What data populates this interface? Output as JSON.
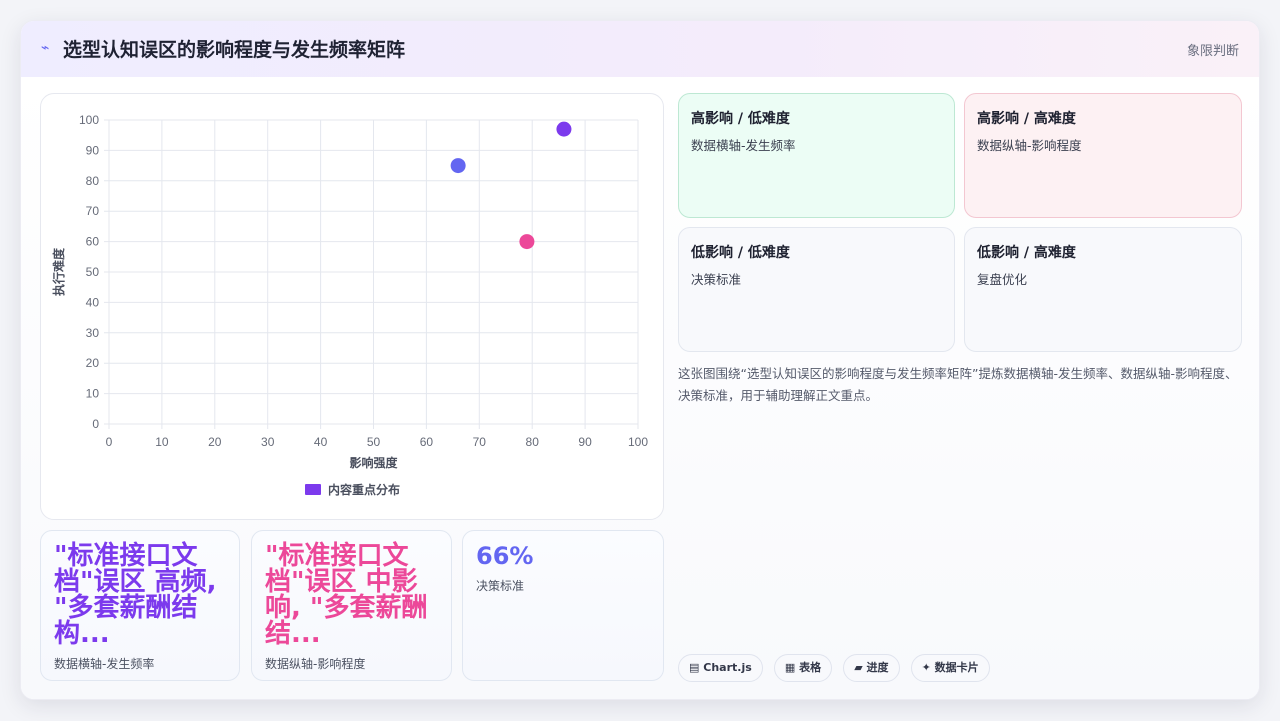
{
  "header": {
    "icon": "lightning-icon",
    "title": "选型认知误区的影响程度与发生频率矩阵",
    "right_label": "象限判断"
  },
  "chart_data": {
    "type": "scatter",
    "xlabel": "影响强度",
    "ylabel": "执行难度",
    "xlim": [
      0,
      100
    ],
    "ylim": [
      0,
      100
    ],
    "xticks": [
      "0",
      "10",
      "20",
      "30",
      "40",
      "50",
      "60",
      "70",
      "80",
      "90",
      "100"
    ],
    "yticks": [
      "0",
      "10",
      "20",
      "30",
      "40",
      "50",
      "60",
      "70",
      "80",
      "90",
      "100"
    ],
    "grid": true,
    "legend_position": "bottom",
    "series": [
      {
        "name": "内容重点分布",
        "color": "#7c3aed",
        "points": [
          {
            "x": 66,
            "y": 85,
            "color": "#6366f1"
          },
          {
            "x": 86,
            "y": 97,
            "color": "#7c3aed"
          },
          {
            "x": 79,
            "y": 60,
            "color": "#ec4899"
          }
        ]
      }
    ]
  },
  "stats": [
    {
      "value": "\"标准接口文档\"误区 高频, \"多套薪酬结构...",
      "label": "数据横轴-发生频率",
      "color": "#7c3aed"
    },
    {
      "value": "\"标准接口文档\"误区 中影响, \"多套薪酬结...",
      "label": "数据纵轴-影响程度",
      "color": "#ec4899"
    },
    {
      "value": "66%",
      "label": "决策标准",
      "color": "#6366f1"
    }
  ],
  "quadrants": [
    {
      "title": "高影响 / 低难度",
      "subtitle": "数据横轴-发生频率",
      "bg": "#ecfdf5",
      "border": "#bde8d3"
    },
    {
      "title": "高影响 / 高难度",
      "subtitle": "数据纵轴-影响程度",
      "bg": "#fdf1f3",
      "border": "#f3c7d1"
    },
    {
      "title": "低影响 / 低难度",
      "subtitle": "决策标准",
      "bg": "#f8f9fc",
      "border": "#e3e7ef"
    },
    {
      "title": "低影响 / 高难度",
      "subtitle": "复盘优化",
      "bg": "#f8f9fc",
      "border": "#e3e7ef"
    }
  ],
  "description": "这张图围绕“选型认知误区的影响程度与发生频率矩阵”提炼数据横轴-发生频率、数据纵轴-影响程度、决策标准，用于辅助理解正文重点。",
  "tags": [
    {
      "icon": "chart-icon",
      "label": "Chart.js"
    },
    {
      "icon": "table-icon",
      "label": "表格"
    },
    {
      "icon": "progress-icon",
      "label": "进度"
    },
    {
      "icon": "sparkle-icon",
      "label": "数据卡片"
    }
  ]
}
